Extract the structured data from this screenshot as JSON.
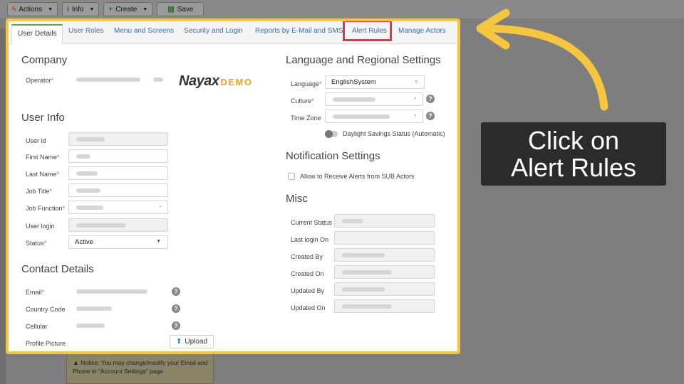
{
  "toolbar": {
    "actions_label": "Actions",
    "info_label": "Info",
    "create_label": "Create",
    "save_label": "Save"
  },
  "tabs": [
    {
      "label": "User Details",
      "active": true
    },
    {
      "label": "User Roles",
      "active": false
    },
    {
      "label": "Menu and Screens",
      "active": false
    },
    {
      "label": "Security and Login",
      "active": false
    },
    {
      "label": "Reports by E-Mail and SMS",
      "active": false
    },
    {
      "label": "Alert Rules",
      "active": false,
      "highlighted": true
    },
    {
      "label": "Manage Actors",
      "active": false
    }
  ],
  "company": {
    "title": "Company",
    "operator_label": "Operator",
    "logo_main": "Nayax",
    "logo_suffix": "DEMO"
  },
  "user_info": {
    "title": "User Info",
    "user_id_label": "User id",
    "first_name_label": "First Name",
    "last_name_label": "Last Name",
    "job_title_label": "Job Title",
    "job_function_label": "Job Function",
    "user_login_label": "User login",
    "status_label": "Status",
    "status_value": "Active"
  },
  "contact": {
    "title": "Contact Details",
    "email_label": "Email",
    "country_code_label": "Country Code",
    "cellular_label": "Cellular",
    "profile_picture_label": "Profile Picture",
    "upload_label": "Upload"
  },
  "notice": {
    "text": "Notice: You may change/modify your Email and Phone in \"Account Settings\" page"
  },
  "language": {
    "title": "Language and Regional Settings",
    "language_label": "Language",
    "language_value": "EnglishSystem",
    "culture_label": "Culture",
    "time_zone_label": "Time Zone",
    "dst_label": "Daylight Savings Status (Automatic)"
  },
  "notification": {
    "title": "Notification Settings",
    "sub_actors_label": "Allow to Receive Alerts from SUB Actors"
  },
  "misc": {
    "title": "Misc",
    "current_status_label": "Current Status",
    "last_login_label": "Last login On",
    "created_by_label": "Created By",
    "created_on_label": "Created On",
    "updated_by_label": "Updated By",
    "updated_on_label": "Updated On"
  },
  "callout": {
    "line1": "Click on",
    "line2": "Alert Rules"
  },
  "colors": {
    "highlight_border": "#f6c73e",
    "tab_highlight": "#e0364f",
    "link": "#3572b8"
  }
}
